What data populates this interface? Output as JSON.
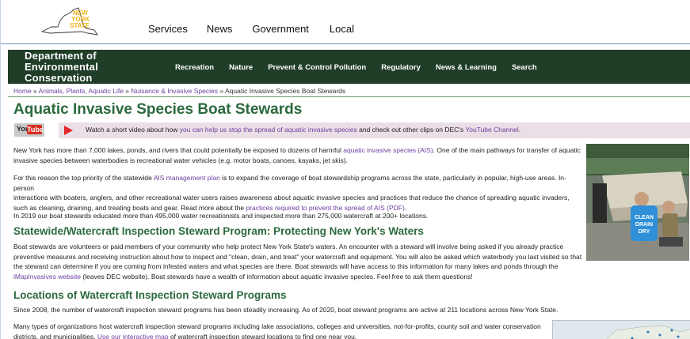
{
  "logo": {
    "line1": "NEW",
    "line2": "YORK",
    "line3": "STATE"
  },
  "topnav": [
    "Services",
    "News",
    "Government",
    "Local"
  ],
  "dept": {
    "line1": "Department of",
    "line2": "Environmental",
    "line3": "Conservation"
  },
  "deptnav": [
    "Recreation",
    "Nature",
    "Prevent & Control Pollution",
    "Regulatory",
    "News & Learning",
    "Search"
  ],
  "breadcrumb": {
    "home": "Home",
    "sep": " » ",
    "animals": "Animals, Plants, Aquatic Life",
    "nuisance": "Nuisance & Invasive Species",
    "current": "Aquatic Invasive Species Boat Stewards"
  },
  "title": "Aquatic Invasive Species Boat Stewards",
  "video": {
    "yt_you": "You",
    "yt_tube": "Tube",
    "pre": "Watch a short video about how ",
    "link1": "you can help us stop the spread of aquatic invasive species",
    "mid": " and check out other clips on DEC's ",
    "link2": "YouTube Channel",
    "post": "."
  },
  "p1": {
    "a": "New York has more than 7,000 lakes, ponds, and rivers that could potentially be exposed to dozens of harmful ",
    "link": "aquatic invasive species (AIS)",
    "b": ". One of the main pathways for transfer of aquatic",
    "c": "invasive species between waterbodies is recreational water vehicles (e.g. motor boats, canoes, kayaks, jet skis)."
  },
  "p2": {
    "a": "For this reason the top priority of the statewide ",
    "link": "AIS management plan",
    "b": " is to expand the coverage of boat stewardship programs across the state, particularly in popular, high-use areas. In-person",
    "c": "interactions with boaters, anglers, and other recreational water users raises awareness about aquatic invasive species and practices that reduce the chance of spreading aquatic invaders,",
    "d": "such as cleaning, draining, and treating boats and gear. Read more about the ",
    "link2": "practices required to prevent the spread of AIS (PDF)",
    "e": "."
  },
  "p3": "In 2019 our boat stewards educated more than 495,000 water recreationists and inspected more than 275,000 watercraft at 200+ locations.",
  "h2a": "Statewide/Watercraft Inspection Steward Program: Protecting New York's Waters",
  "p4": {
    "a": "Boat stewards are volunteers or paid members of your community who help protect New York State's waters. An encounter with a steward will involve being asked if you already practice",
    "b": "preventive measures and receiving instruction about how to inspect and \"clean, drain, and treat\" your watercraft and equipment. You will also be asked which waterbody you last visited so that",
    "c": "the steward can determine if you are coming from infested waters and what species are there. Boat stewards will have access to this information for many lakes and ponds through the",
    "link": "iMapInvasives website",
    "d": " (leaves DEC website). Boat stewards have a wealth of information about aquatic invasive species. Feel free to ask them questions!"
  },
  "h2b": "Locations of Watercraft Inspection Steward Programs",
  "p5": "Since 2008, the number of watercraft inspection steward programs has been steadily increasing. As of 2020, boat steward programs are active at 211 locations across New York State.",
  "p6": {
    "a": "Many types of organizations host watercraft inspection steward programs including lake associations, colleges and universities, not-for-profits, county soil and water conservation",
    "b": "districts, and municipalities. ",
    "link": "Use our interactive map",
    "c": " of watercraft inspection steward locations to find one near you."
  },
  "photo_sign": {
    "l1": "CLEAN",
    "l2": "DRAIN",
    "l3": "DRY"
  },
  "colors": {
    "green_header": "#203d28",
    "heading_green": "#2c6a3e",
    "link_purple": "#6b3fa0"
  }
}
